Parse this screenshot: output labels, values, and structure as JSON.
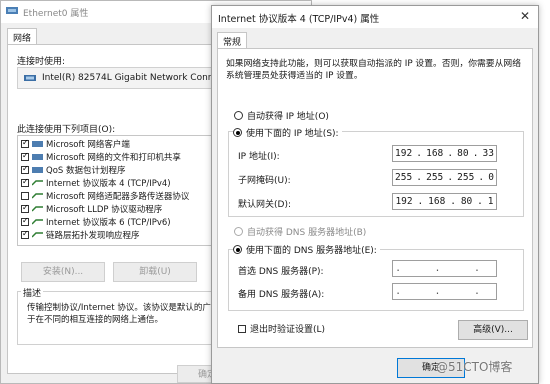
{
  "back_window": {
    "title": "Ethernet0 属性",
    "tab": "网络",
    "connect_using_label": "连接时使用:",
    "adapter_name": "Intel(R) 82574L Gigabit Network Conne",
    "items_label": "此连接使用下列项目(O):",
    "items": [
      {
        "label": "Microsoft 网络客户端",
        "checked": true
      },
      {
        "label": "Microsoft 网络的文件和打印机共享",
        "checked": true
      },
      {
        "label": "QoS 数据包计划程序",
        "checked": true
      },
      {
        "label": "Internet 协议版本 4 (TCP/IPv4)",
        "checked": true
      },
      {
        "label": "Microsoft 网络适配器多路传送器协议",
        "checked": false
      },
      {
        "label": "Microsoft LLDP 协议驱动程序",
        "checked": true
      },
      {
        "label": "Internet 协议版本 6 (TCP/IPv6)",
        "checked": true
      },
      {
        "label": "链路层拓扑发现响应程序",
        "checked": true
      }
    ],
    "install_button": "安装(N)...",
    "uninstall_button": "卸载(U)",
    "description_label": "描述",
    "description_text": "传输控制协议/Internet 协议。该协议是默认的广\n于在不同的相互连接的网络上通信。",
    "ok_button_partial": "确定"
  },
  "front_window": {
    "title": "Internet 协议版本 4 (TCP/IPv4) 属性",
    "tab": "常规",
    "intro_text": "如果网络支持此功能，则可以获取自动指派的 IP 设置。否则，你需要从网络\n系统管理员处获得适当的 IP 设置。",
    "auto_ip_label": "自动获得 IP 地址(O)",
    "use_ip_label": "使用下面的 IP 地址(S):",
    "ip_address_label": "IP 地址(I):",
    "ip_address": [
      "192",
      "168",
      "80",
      "33"
    ],
    "subnet_label": "子网掩码(U):",
    "subnet": [
      "255",
      "255",
      "255",
      "0"
    ],
    "gateway_label": "默认网关(D):",
    "gateway": [
      "192",
      "168",
      "80",
      "1"
    ],
    "auto_dns_label": "自动获得 DNS 服务器地址(B)",
    "use_dns_label": "使用下面的 DNS 服务器地址(E):",
    "preferred_dns_label": "首选 DNS 服务器(P):",
    "alternate_dns_label": "备用 DNS 服务器(A):",
    "dns_dots": ". . .",
    "validate_label": "退出时验证设置(L)",
    "advanced_button": "高级(V)...",
    "ok_button": "确定"
  },
  "watermark": "@51CTO博客"
}
